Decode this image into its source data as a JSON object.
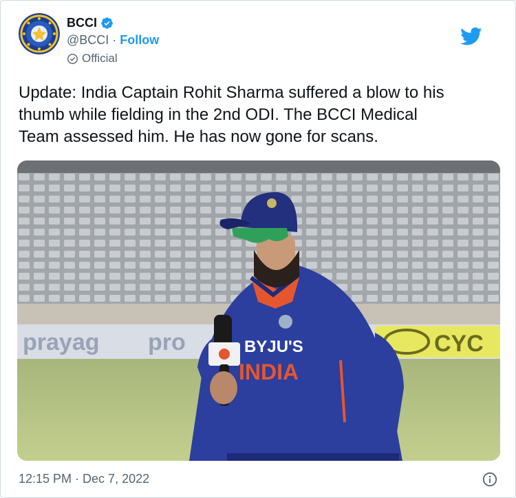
{
  "account": {
    "name": "BCCI",
    "handle": "@BCCI",
    "separator": "·",
    "follow_label": "Follow",
    "official_label": "Official",
    "avatar_icon": "bcci-logo-icon",
    "verified_icon": "verified-badge-icon",
    "brand_icon": "twitter-bird-icon"
  },
  "tweet": {
    "lines": [
      "Update: India Captain Rohit Sharma suffered a blow to his",
      "thumb while fielding in the 2nd ODI. The BCCI Medical",
      "Team assessed him. He has now gone for scans."
    ],
    "media": {
      "jersey_sponsor": "BYJU'S",
      "jersey_text": "INDIA",
      "board_left": "prayag",
      "board_mid": "pro",
      "board_right": "CYC"
    },
    "timestamp": "12:15 PM · Dec 7, 2022",
    "info_icon": "info-icon"
  },
  "colors": {
    "accent": "#1d9bf0",
    "text_primary": "#0f1419",
    "text_secondary": "#536471",
    "jersey_blue": "#2c3e9e"
  }
}
